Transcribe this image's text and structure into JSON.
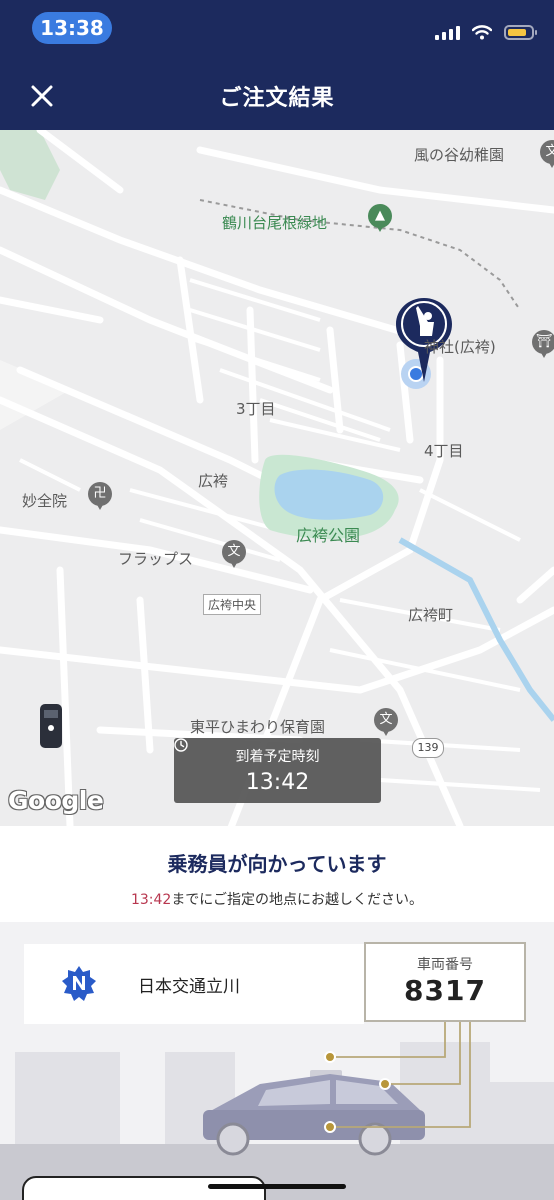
{
  "status_bar": {
    "time": "13:38"
  },
  "header": {
    "title": "ご注文結果"
  },
  "map": {
    "labels": {
      "kindergarten": "風の谷幼稚園",
      "green_area": "鶴川台尾根緑地",
      "shrine": "神社(広袴)",
      "block3": "3丁目",
      "block4": "4丁目",
      "hirohakama": "広袴",
      "temple": "妙全院",
      "park": "広袴公園",
      "flaps": "フラップス",
      "bus_stop": "広袴中央",
      "hirohakama_town": "広袴町",
      "nursery": "東平ひまわり保育園"
    },
    "route_number": "139",
    "google": "Google"
  },
  "eta": {
    "label": "到着予定時刻",
    "time": "13:42"
  },
  "info": {
    "title": "乗務員が向かっています",
    "time": "13:42",
    "message": "までにご指定の地点にお越しください。"
  },
  "driver": {
    "company": "日本交通立川",
    "car_number_label": "車両番号",
    "car_number": "8317"
  },
  "colors": {
    "header": "#1c2a5e",
    "accent_time": "#b8374f",
    "pin": "#1c2a5e",
    "location_dot": "#3a7be0"
  }
}
